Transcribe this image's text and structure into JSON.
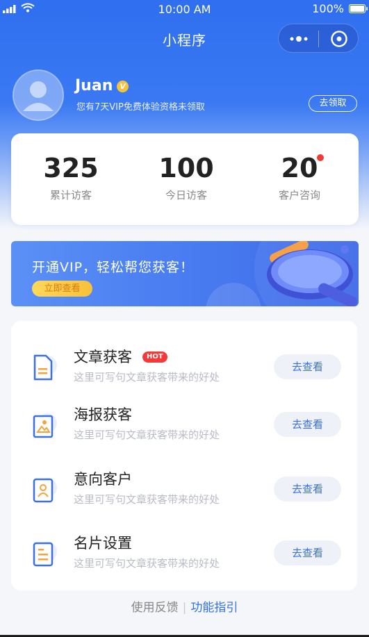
{
  "status_bar": {
    "time": "10:00 AM",
    "battery": "100%"
  },
  "nav": {
    "title": "小程序"
  },
  "profile": {
    "name": "Juan",
    "vip_badge": "V",
    "note": "您有7天VIP免费体验资格未领取",
    "claim_label": "去领取"
  },
  "stats": [
    {
      "value": "325",
      "label": "累计访客"
    },
    {
      "value": "100",
      "label": "今日访客"
    },
    {
      "value": "20",
      "label": "客户咨询"
    }
  ],
  "banner": {
    "title": "开通VIP，轻松帮您获客！",
    "cta": "立即查看"
  },
  "features": [
    {
      "title": "文章获客",
      "desc": "这里可写句文章获客带来的好处",
      "badge": "HOT",
      "action": "去查看",
      "icon": "document-icon"
    },
    {
      "title": "海报获客",
      "desc": "这里可写句文章获客带来的好处",
      "action": "去查看",
      "icon": "image-icon"
    },
    {
      "title": "意向客户",
      "desc": "这里可写句文章获客带来的好处",
      "action": "去查看",
      "icon": "contact-card-icon"
    },
    {
      "title": "名片设置",
      "desc": "这里可写句文章获客带来的好处",
      "action": "去查看",
      "icon": "business-card-icon"
    }
  ],
  "footer": {
    "feedback": "使用反馈",
    "divider": "|",
    "guide": "功能指引"
  },
  "colors": {
    "primary": "#2f6ff0",
    "hot": "#f23a3a",
    "vip_gold": "#f5c33a"
  }
}
